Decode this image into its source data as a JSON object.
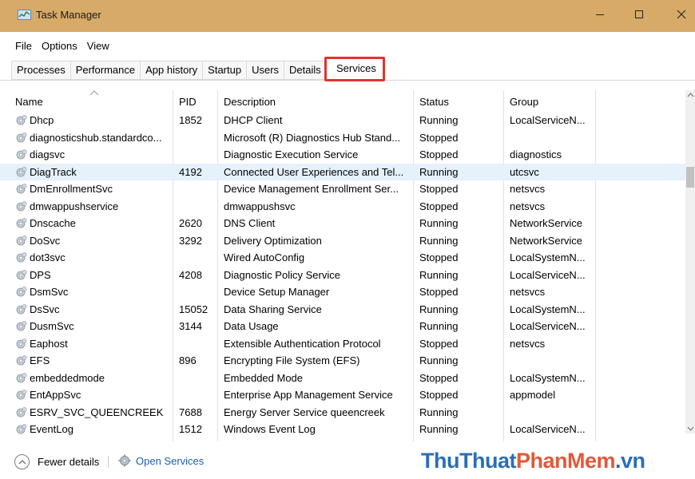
{
  "window": {
    "title": "Task Manager",
    "controls": {
      "minimize": "minimize-icon",
      "maximize": "maximize-icon",
      "close": "close-icon"
    },
    "titlebar_color": "#d7aa67"
  },
  "menu": [
    "File",
    "Options",
    "View"
  ],
  "tabs": [
    "Processes",
    "Performance",
    "App history",
    "Startup",
    "Users",
    "Details",
    "Services"
  ],
  "active_tab": "Services",
  "highlight_color": "#e4322e",
  "table": {
    "columns": [
      "Name",
      "PID",
      "Description",
      "Status",
      "Group"
    ],
    "rows": [
      {
        "name": "Dhcp",
        "pid": "1852",
        "description": "DHCP Client",
        "status": "Running",
        "group": "LocalServiceN..."
      },
      {
        "name": "diagnosticshub.standardco...",
        "pid": "",
        "description": "Microsoft (R) Diagnostics Hub Stand...",
        "status": "Stopped",
        "group": ""
      },
      {
        "name": "diagsvc",
        "pid": "",
        "description": "Diagnostic Execution Service",
        "status": "Stopped",
        "group": "diagnostics"
      },
      {
        "name": "DiagTrack",
        "pid": "4192",
        "description": "Connected User Experiences and Tel...",
        "status": "Running",
        "group": "utcsvc",
        "selected": true
      },
      {
        "name": "DmEnrollmentSvc",
        "pid": "",
        "description": "Device Management Enrollment Ser...",
        "status": "Stopped",
        "group": "netsvcs"
      },
      {
        "name": "dmwappushservice",
        "pid": "",
        "description": "dmwappushsvc",
        "status": "Stopped",
        "group": "netsvcs"
      },
      {
        "name": "Dnscache",
        "pid": "2620",
        "description": "DNS Client",
        "status": "Running",
        "group": "NetworkService"
      },
      {
        "name": "DoSvc",
        "pid": "3292",
        "description": "Delivery Optimization",
        "status": "Running",
        "group": "NetworkService"
      },
      {
        "name": "dot3svc",
        "pid": "",
        "description": "Wired AutoConfig",
        "status": "Stopped",
        "group": "LocalSystemN..."
      },
      {
        "name": "DPS",
        "pid": "4208",
        "description": "Diagnostic Policy Service",
        "status": "Running",
        "group": "LocalServiceN..."
      },
      {
        "name": "DsmSvc",
        "pid": "",
        "description": "Device Setup Manager",
        "status": "Stopped",
        "group": "netsvcs"
      },
      {
        "name": "DsSvc",
        "pid": "15052",
        "description": "Data Sharing Service",
        "status": "Running",
        "group": "LocalSystemN..."
      },
      {
        "name": "DusmSvc",
        "pid": "3144",
        "description": "Data Usage",
        "status": "Running",
        "group": "LocalServiceN..."
      },
      {
        "name": "Eaphost",
        "pid": "",
        "description": "Extensible Authentication Protocol",
        "status": "Stopped",
        "group": "netsvcs"
      },
      {
        "name": "EFS",
        "pid": "896",
        "description": "Encrypting File System (EFS)",
        "status": "Running",
        "group": ""
      },
      {
        "name": "embeddedmode",
        "pid": "",
        "description": "Embedded Mode",
        "status": "Stopped",
        "group": "LocalSystemN..."
      },
      {
        "name": "EntAppSvc",
        "pid": "",
        "description": "Enterprise App Management Service",
        "status": "Stopped",
        "group": "appmodel"
      },
      {
        "name": "ESRV_SVC_QUEENCREEK",
        "pid": "7688",
        "description": "Energy Server Service queencreek",
        "status": "Running",
        "group": ""
      },
      {
        "name": "EventLog",
        "pid": "1512",
        "description": "Windows Event Log",
        "status": "Running",
        "group": "LocalServiceN..."
      }
    ]
  },
  "footer": {
    "fewer_details": "Fewer details",
    "open_services": "Open Services"
  },
  "watermark": {
    "part1": "ThuThuat",
    "part2": "PhanMem",
    "part3": ".vn"
  }
}
